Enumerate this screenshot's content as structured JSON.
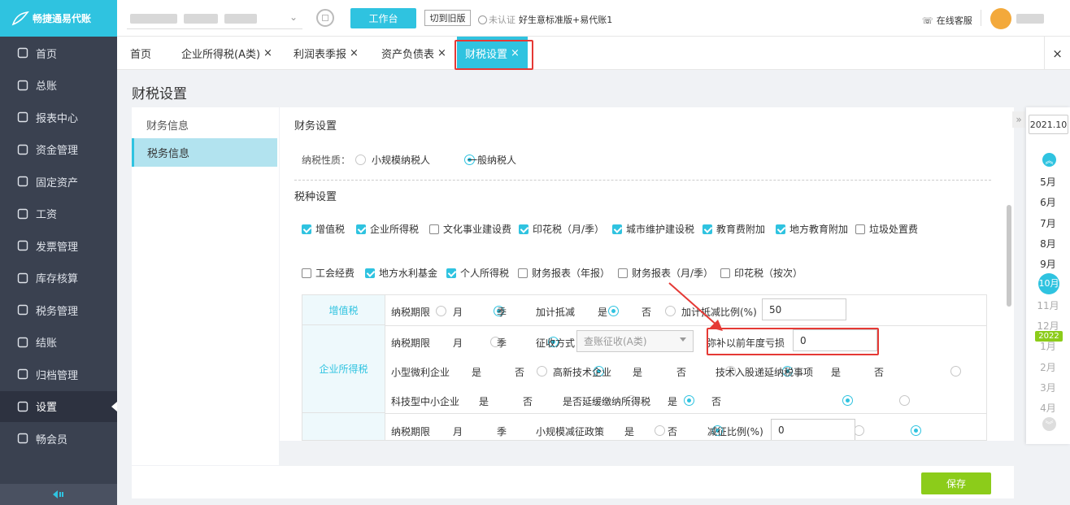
{
  "brand": {
    "name": "畅捷通易代账"
  },
  "sidebar": {
    "items": [
      {
        "label": "首页",
        "icon": "home-icon"
      },
      {
        "label": "总账",
        "icon": "ledger-icon"
      },
      {
        "label": "报表中心",
        "icon": "chart-icon"
      },
      {
        "label": "资金管理",
        "icon": "money-icon"
      },
      {
        "label": "固定资产",
        "icon": "building-icon"
      },
      {
        "label": "工资",
        "icon": "salary-icon"
      },
      {
        "label": "发票管理",
        "icon": "invoice-icon"
      },
      {
        "label": "库存核算",
        "icon": "warehouse-icon"
      },
      {
        "label": "税务管理",
        "icon": "tax-icon"
      },
      {
        "label": "结账",
        "icon": "checkout-icon"
      },
      {
        "label": "归档管理",
        "icon": "archive-icon"
      },
      {
        "label": "设置",
        "icon": "gear-icon"
      },
      {
        "label": "畅会员",
        "icon": "vip-icon"
      }
    ],
    "active_index": 11
  },
  "topbar": {
    "workbench_label": "工作台",
    "old_version_label": "切到旧版",
    "cert_status": "未认证",
    "account_name": "好生意标准版+易代账1",
    "support_label": "在线客服"
  },
  "tabs": [
    {
      "label": "首页",
      "closable": false
    },
    {
      "label": "企业所得税(A类)",
      "closable": true
    },
    {
      "label": "利润表季报",
      "closable": true
    },
    {
      "label": "资产负债表",
      "closable": true
    },
    {
      "label": "财税设置",
      "closable": true,
      "active": true
    }
  ],
  "page_title": "财税设置",
  "left_menu": {
    "items": [
      "财务信息",
      "税务信息"
    ],
    "active_index": 1
  },
  "finance_section": {
    "title": "财务设置",
    "taxpayer_label": "纳税性质：",
    "options": [
      "小规模纳税人",
      "一般纳税人"
    ],
    "selected": "一般纳税人"
  },
  "tax_section": {
    "title": "税种设置",
    "row1": [
      {
        "label": "增值税",
        "checked": true
      },
      {
        "label": "企业所得税",
        "checked": true
      },
      {
        "label": "文化事业建设费",
        "checked": false
      },
      {
        "label": "印花税（月/季）",
        "checked": true
      },
      {
        "label": "城市维护建设税",
        "checked": true
      },
      {
        "label": "教育费附加",
        "checked": true
      },
      {
        "label": "地方教育附加",
        "checked": true
      },
      {
        "label": "垃圾处置费",
        "checked": false
      }
    ],
    "row2": [
      {
        "label": "工会经费",
        "checked": false
      },
      {
        "label": "地方水利基金",
        "checked": true
      },
      {
        "label": "个人所得税",
        "checked": true
      },
      {
        "label": "财务报表（年报）",
        "checked": false
      },
      {
        "label": "财务报表（月/季）",
        "checked": false
      },
      {
        "label": "印花税（按次）",
        "checked": false
      }
    ]
  },
  "vat": {
    "name": "增值税",
    "period_label": "纳税期限",
    "opt_month": "月",
    "opt_quarter": "季",
    "deduct_label": "加计抵减",
    "opt_yes": "是",
    "opt_no": "否",
    "ratio_label": "加计抵减比例(%)",
    "ratio_value": "50"
  },
  "cit": {
    "name": "企业所得税",
    "period_label": "纳税期限",
    "opt_month": "月",
    "opt_quarter": "季",
    "method_label": "征收方式",
    "method_value": "查账征收(A类)",
    "loss_label": "弥补以前年度亏损",
    "loss_value": "0",
    "small_label": "小型微利企业",
    "hightech_label": "高新技术企业",
    "tech_label": "技术入股递延纳税事项",
    "sme_label": "科技型中小企业",
    "defer_label": "是否延缓缴纳所得税",
    "opt_yes": "是",
    "opt_no": "否"
  },
  "third_row": {
    "period_label": "纳税期限",
    "opt_month": "月",
    "opt_quarter": "季",
    "policy_label": "小规模减征政策",
    "opt_yes": "是",
    "opt_no": "否",
    "ratio_label": "减征比例(%)",
    "ratio_value": "0"
  },
  "timeline": {
    "current": "2021.10",
    "months": [
      "5月",
      "6月",
      "7月",
      "8月",
      "9月",
      "10月",
      "11月",
      "12月",
      "1月",
      "2月",
      "3月",
      "4月"
    ],
    "year_badge": "2022",
    "active_month": "10月"
  },
  "save_label": "保存"
}
